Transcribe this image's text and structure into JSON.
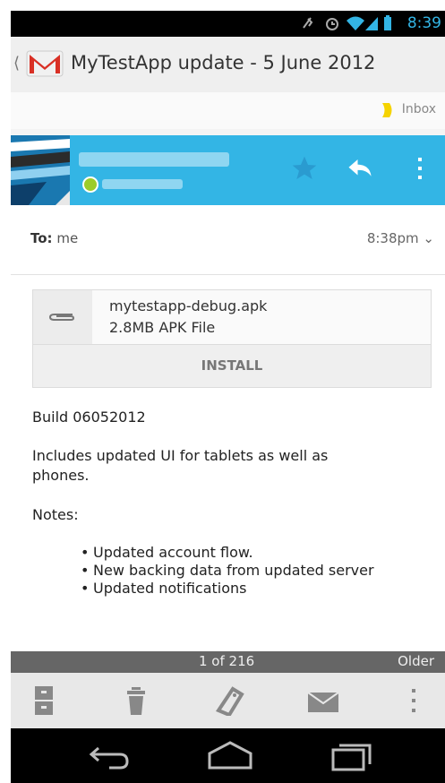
{
  "status_bar": {
    "time": "8:39"
  },
  "action_bar": {
    "title": "MyTestApp update - 5 June 2012"
  },
  "label": {
    "name": "Inbox"
  },
  "header": {
    "to_label": "To:",
    "to_value": "me",
    "time": "8:38pm"
  },
  "attachment": {
    "filename": "mytestapp-debug.apk",
    "size": "2.8MB APK File",
    "action": "INSTALL"
  },
  "body": {
    "line1": "Build 06052012",
    "line2": "Includes updated UI for tablets as well as",
    "line3": "phones.",
    "notes": "Notes:",
    "bullets": [
      "Updated account flow.",
      "New backing data from updated server",
      "Updated notifications"
    ]
  },
  "pager": {
    "count": "1 of 216",
    "older": "Older"
  },
  "colors": {
    "accent": "#33b5e5",
    "presence": "#9ccc2a"
  }
}
